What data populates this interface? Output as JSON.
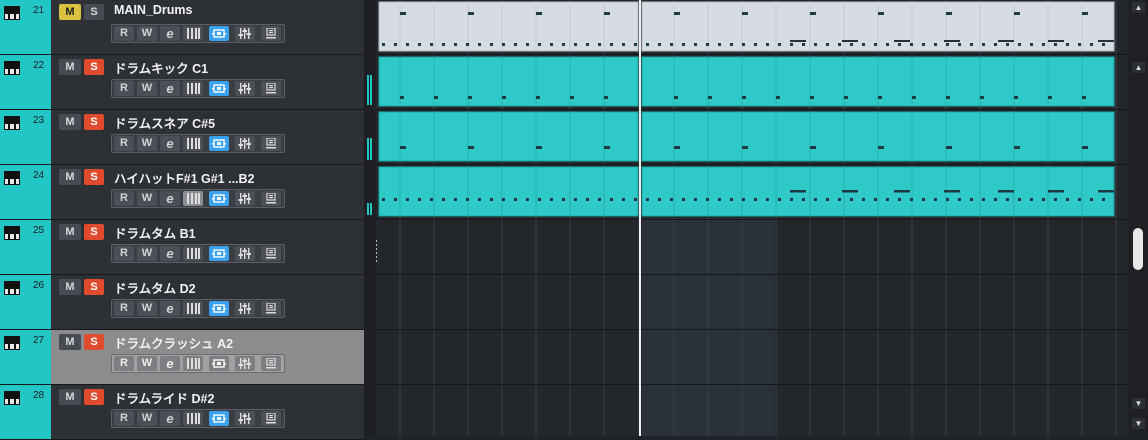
{
  "colors": {
    "track": "#22c7c5",
    "mute_on": "#d9c240",
    "solo_on": "#e04b2e",
    "active_tool": "#3aa0f0",
    "folder_part": "#d7dce2",
    "midi_part": "#2fcac8",
    "grid_bg": "#23272c"
  },
  "buttons": {
    "mute": "M",
    "solo": "S",
    "read": "R",
    "write": "W",
    "edit": "e"
  },
  "icons": [
    "keyboard-icon",
    "edit-instrument-icon",
    "midi-keyboard-icon",
    "monitor-icon",
    "channel-settings-icon",
    "inserts-icon"
  ],
  "tracks": [
    {
      "num": "21",
      "name": "MAIN_Drums",
      "mute": true,
      "solo": false,
      "selected": false
    },
    {
      "num": "22",
      "name": "ドラムキック C1",
      "mute": false,
      "solo": true,
      "selected": false
    },
    {
      "num": "23",
      "name": "ドラムスネア C#5",
      "mute": false,
      "solo": true,
      "selected": false
    },
    {
      "num": "24",
      "name": "ハイハットF#1 G#1 ...B2",
      "mute": false,
      "solo": true,
      "selected": false,
      "kb_lit": true
    },
    {
      "num": "25",
      "name": "ドラムタム B1",
      "mute": false,
      "solo": true,
      "selected": false
    },
    {
      "num": "26",
      "name": "ドラムタム D2",
      "mute": false,
      "solo": true,
      "selected": false
    },
    {
      "num": "27",
      "name": "ドラムクラッシュ A2",
      "mute": false,
      "solo": true,
      "selected": true
    },
    {
      "num": "28",
      "name": "ドラムライド D#2",
      "mute": false,
      "solo": true,
      "selected": false
    }
  ],
  "meters": [
    {
      "track": 1,
      "level": 0.75
    },
    {
      "track": 2,
      "level": 0.55
    },
    {
      "track": 3,
      "level": 0.3
    }
  ],
  "scroll": {
    "up": "▲",
    "down": "▼",
    "position": 0.55
  }
}
